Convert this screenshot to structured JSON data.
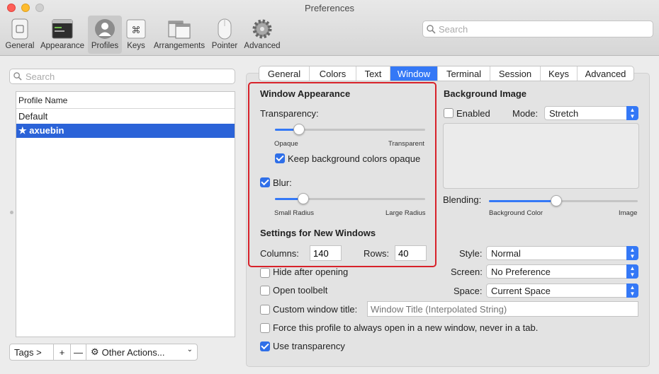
{
  "window": {
    "title": "Preferences"
  },
  "toolbar": {
    "items": [
      {
        "label": "General",
        "icon": "general-icon"
      },
      {
        "label": "Appearance",
        "icon": "appearance-icon"
      },
      {
        "label": "Profiles",
        "icon": "profiles-icon",
        "selected": true
      },
      {
        "label": "Keys",
        "icon": "keys-icon"
      },
      {
        "label": "Arrangements",
        "icon": "arrangements-icon"
      },
      {
        "label": "Pointer",
        "icon": "pointer-icon"
      },
      {
        "label": "Advanced",
        "icon": "advanced-icon"
      }
    ],
    "search_placeholder": "Search"
  },
  "profiles": {
    "search_placeholder": "Search",
    "column_header": "Profile Name",
    "rows": [
      {
        "name": "Default",
        "selected": false
      },
      {
        "name": "axuebin",
        "selected": true,
        "default_star": "★"
      }
    ],
    "bottom": {
      "tags": "Tags >",
      "add": "+",
      "remove": "—",
      "other_actions": "Other Actions..."
    }
  },
  "tabs": [
    {
      "label": "General"
    },
    {
      "label": "Colors"
    },
    {
      "label": "Text"
    },
    {
      "label": "Window",
      "active": true
    },
    {
      "label": "Terminal"
    },
    {
      "label": "Session"
    },
    {
      "label": "Keys"
    },
    {
      "label": "Advanced"
    }
  ],
  "window_appearance": {
    "title": "Window Appearance",
    "transparency_label": "Transparency:",
    "transparency_value": 0.16,
    "min_label": "Opaque",
    "max_label": "Transparent",
    "keep_opaque_label": "Keep background colors opaque",
    "keep_opaque_checked": true,
    "blur_label": "Blur:",
    "blur_checked": true,
    "blur_value": 0.19,
    "blur_min_label": "Small Radius",
    "blur_max_label": "Large Radius"
  },
  "new_windows": {
    "title": "Settings for New Windows",
    "columns_label": "Columns:",
    "columns_value": "140",
    "rows_label": "Rows:",
    "rows_value": "40"
  },
  "background_image": {
    "title": "Background Image",
    "enabled_label": "Enabled",
    "enabled_checked": false,
    "mode_label": "Mode:",
    "mode_value": "Stretch",
    "blending_label": "Blending:",
    "blending_value": 0.45,
    "blending_min_label": "Background Color",
    "blending_max_label": "Image"
  },
  "other": {
    "style_label": "Style:",
    "style_value": "Normal",
    "screen_label": "Screen:",
    "screen_value": "No Preference",
    "space_label": "Space:",
    "space_value": "Current Space",
    "hide_after_opening": "Hide after opening",
    "open_toolbelt": "Open toolbelt",
    "custom_title_label": "Custom window title:",
    "custom_title_placeholder": "Window Title (Interpolated String)",
    "force_new_window": "Force this profile to always open in a new window, never in a tab.",
    "use_transparency": "Use transparency",
    "use_transparency_checked": true
  },
  "colors": {
    "accent": "#3478f6",
    "highlight": "#d8222a",
    "selection": "#2b63d8"
  }
}
